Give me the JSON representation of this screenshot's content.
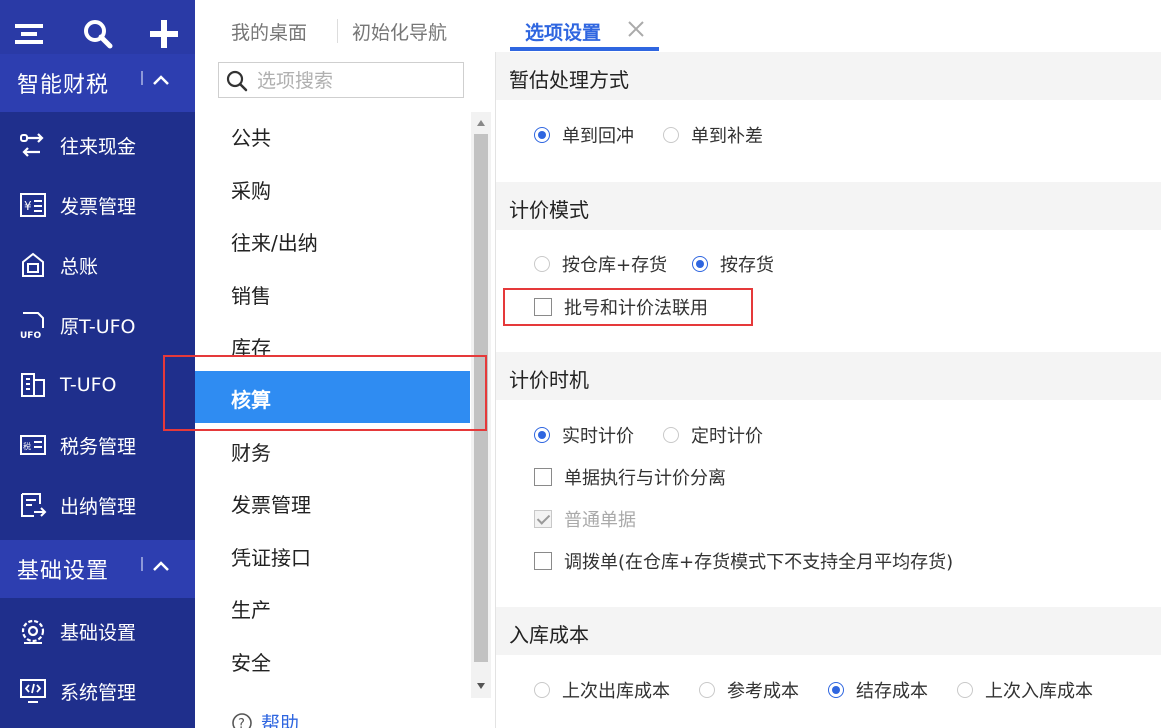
{
  "sidebar": {
    "top_icons": [
      "menu-icon",
      "search-icon",
      "plus-icon"
    ],
    "group1": {
      "label": "智能财税"
    },
    "items1": [
      {
        "label": "往来现金",
        "icon": "transfer-icon"
      },
      {
        "label": "发票管理",
        "icon": "invoice-icon"
      },
      {
        "label": "总账",
        "icon": "ledger-icon"
      },
      {
        "label": "原T-UFO",
        "icon": "ufo-icon"
      },
      {
        "label": "T-UFO",
        "icon": "building-icon"
      },
      {
        "label": "税务管理",
        "icon": "tax-icon"
      },
      {
        "label": "出纳管理",
        "icon": "cashier-icon"
      }
    ],
    "group2": {
      "label": "基础设置"
    },
    "items2": [
      {
        "label": "基础设置",
        "icon": "settings-gear-icon"
      },
      {
        "label": "系统管理",
        "icon": "system-monitor-icon"
      }
    ],
    "bg_color": "#1f2f8c"
  },
  "tabs": [
    {
      "label": "我的桌面"
    },
    {
      "label": "初始化导航"
    },
    {
      "label": "选项设置",
      "active": true
    }
  ],
  "search": {
    "placeholder": "选项搜索",
    "value": ""
  },
  "categories": [
    "公共",
    "采购",
    "往来/出纳",
    "销售",
    "库存",
    "核算",
    "财务",
    "发票管理",
    "凭证接口",
    "生产",
    "安全"
  ],
  "active_category": "核算",
  "help_label": "帮助",
  "sections": {
    "s1": {
      "title": "暂估处理方式",
      "r1": "单到回冲",
      "r2": "单到补差",
      "selected": "单到回冲"
    },
    "s2": {
      "title": "计价模式",
      "r1": "按仓库+存货",
      "r2": "按存货",
      "selected": "按存货",
      "c1": "批号和计价法联用",
      "c1_checked": false
    },
    "s3": {
      "title": "计价时机",
      "r1": "实时计价",
      "r2": "定时计价",
      "selected": "实时计价",
      "c1": "单据执行与计价分离",
      "c1_checked": false,
      "c2": "普通单据",
      "c2_checked": true,
      "c2_disabled": true,
      "c3": "调拨单(在仓库+存货模式下不支持全月平均存货)",
      "c3_checked": false
    },
    "s4": {
      "title": "入库成本",
      "r1": "上次出库成本",
      "r2": "参考成本",
      "r3": "结存成本",
      "r4": "上次入库成本",
      "selected": "结存成本"
    }
  },
  "colors": {
    "accent": "#2f66e0",
    "active_item": "#2f8cf2",
    "highlight": "#e5393a"
  }
}
